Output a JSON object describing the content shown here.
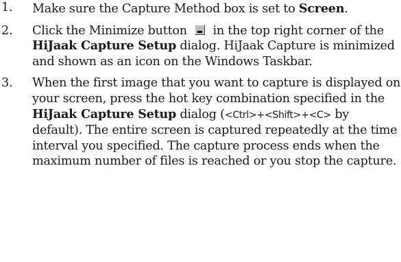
{
  "steps": [
    {
      "number": "1.",
      "parts": [
        "Make sure the Capture Method box is set to ",
        "Screen",
        "."
      ]
    },
    {
      "number": "2.",
      "parts": [
        "Click the Minimize button ",
        " in the top right corner of the ",
        "HiJaak Capture Setup",
        " dialog. HiJaak Capture is minimized and shown as an icon on the Windows Taskbar."
      ],
      "icon": "minimize-button-icon"
    },
    {
      "number": "3.",
      "parts": [
        "When the first image that you want to capture is displayed on your screen, press the hot key combination specified in the ",
        "HiJaak Capture Setup",
        " dialog (",
        "<Ctrl>+<Shift>+<C>",
        " by default). The entire screen is captured repeatedly at the time interval you specified. The capture process ends when the maximum number of files is reached or you stop the capture."
      ]
    }
  ]
}
